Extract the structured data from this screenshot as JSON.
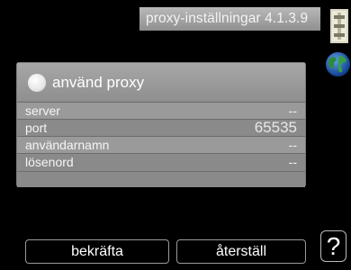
{
  "header": {
    "title": "proxy-inställningar 4.1.3.9"
  },
  "icons": {
    "settings": "settings-icon",
    "globe": "globe-icon"
  },
  "proxy": {
    "toggle_label": "använd proxy",
    "fields": [
      {
        "label": "server",
        "value": "--"
      },
      {
        "label": "port",
        "value": "65535"
      },
      {
        "label": "användarnamn",
        "value": "--"
      },
      {
        "label": "lösenord",
        "value": "--"
      }
    ]
  },
  "footer": {
    "confirm_label": "bekräfta",
    "reset_label": "återställ",
    "help_label": "?"
  },
  "colors": {
    "background": "#000000",
    "panel": "#8c8c8c",
    "title_bar": "#a8a8a8",
    "text": "#ffffff"
  }
}
